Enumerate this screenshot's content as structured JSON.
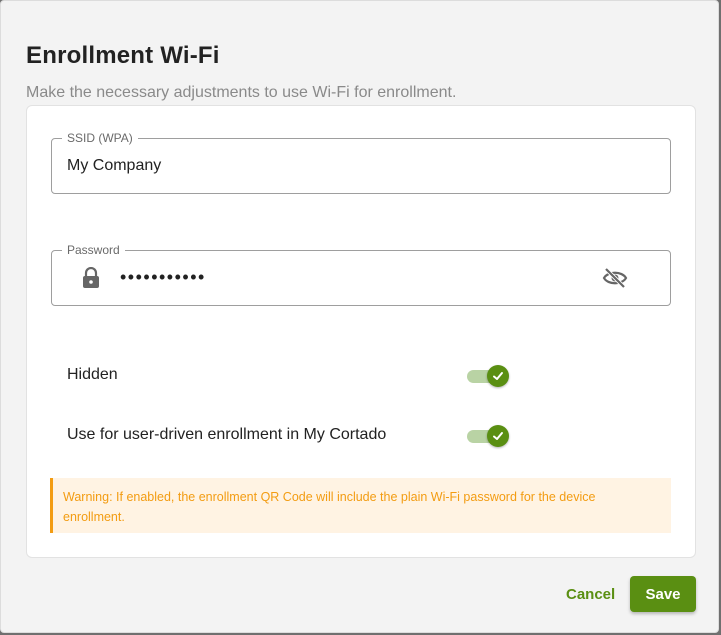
{
  "dialog": {
    "title": "Enrollment Wi-Fi",
    "subtitle": "Make the necessary adjustments to use Wi-Fi for enrollment."
  },
  "ssid": {
    "label": "SSID (WPA)",
    "value": "My Company"
  },
  "password": {
    "label": "Password",
    "masked_value": "•••••••••••",
    "lock_icon": "lock-icon",
    "visibility_icon": "eye-off-icon"
  },
  "options": {
    "hidden": {
      "label": "Hidden",
      "enabled": true
    },
    "user_driven": {
      "label": "Use for user-driven enrollment in My Cortado",
      "enabled": true
    }
  },
  "warning": {
    "text": "Warning: If enabled, the enrollment QR Code will include the plain Wi-Fi password for the device enrollment."
  },
  "actions": {
    "cancel_label": "Cancel",
    "save_label": "Save"
  },
  "colors": {
    "accent": "#5a8f12",
    "warning_text": "#f39c12",
    "warning_background": "#fff3e3"
  }
}
